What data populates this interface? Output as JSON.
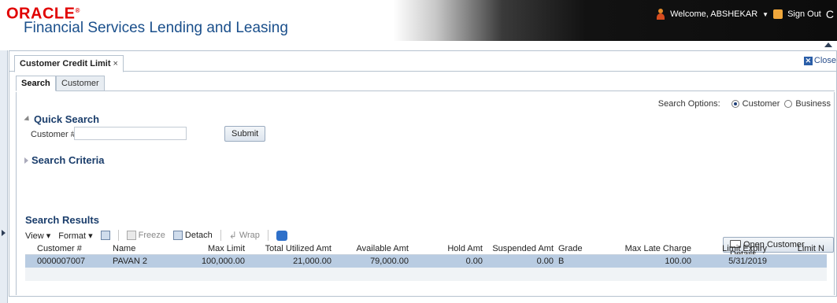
{
  "header": {
    "logo_text": "ORACLE",
    "logo_mark": "®",
    "product_name": "Financial Services Lending and Leasing",
    "welcome_text": "Welcome, ABSHEKAR",
    "signout_label": "Sign Out"
  },
  "document_tab": {
    "label": "Customer Credit Limit",
    "close_x": "×",
    "close_link": "Close"
  },
  "sub_tabs": [
    {
      "label": "Search",
      "active": true
    },
    {
      "label": "Customer",
      "active": false
    }
  ],
  "search_options": {
    "label": "Search Options:",
    "options": [
      {
        "label": "Customer",
        "selected": true
      },
      {
        "label": "Business",
        "selected": false
      }
    ]
  },
  "quick_search": {
    "title": "Quick Search",
    "field_label": "Customer #",
    "field_value": "",
    "submit_label": "Submit"
  },
  "search_criteria": {
    "title": "Search Criteria"
  },
  "open_details_button": "Open Customer Details",
  "results": {
    "title": "Search Results",
    "toolbar": {
      "view_label": "View ▾",
      "format_label": "Format ▾",
      "freeze_label": "Freeze",
      "detach_label": "Detach",
      "wrap_label": "Wrap"
    },
    "columns": [
      "Customer #",
      "Name",
      "Max Limit",
      "Total Utilized Amt",
      "Available Amt",
      "Hold Amt",
      "Suspended Amt",
      "Grade",
      "Max Late Charge",
      "Limit Expiry",
      "Limit N"
    ],
    "rows": [
      [
        "0000007007",
        "PAVAN 2",
        "100,000.00",
        "21,000.00",
        "79,000.00",
        "0.00",
        "0.00",
        "B",
        "100.00",
        "5/31/2019",
        ""
      ]
    ]
  }
}
